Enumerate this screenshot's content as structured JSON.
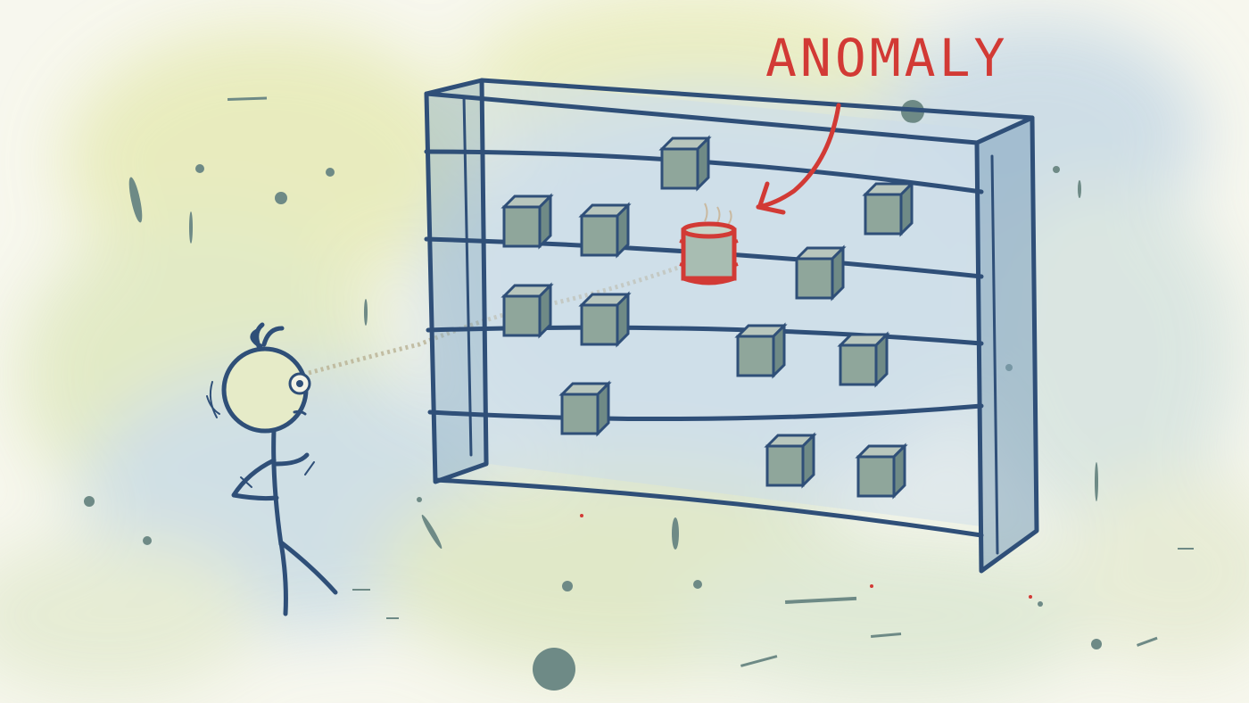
{
  "illustration": {
    "annotation_label": "ANOMALY",
    "colors": {
      "ink": "#2f4f78",
      "accent": "#d23a35",
      "background": "#f7f7ee",
      "wash_blue": "#bcd3e3",
      "wash_yellow": "#e8ecb9",
      "cube_fill": "#8fa69b"
    },
    "scene": {
      "figure": "stick-figure-observer",
      "shelf_rows": 4,
      "normal_items": "cube",
      "anomalous_item": "cylinder-can"
    }
  }
}
